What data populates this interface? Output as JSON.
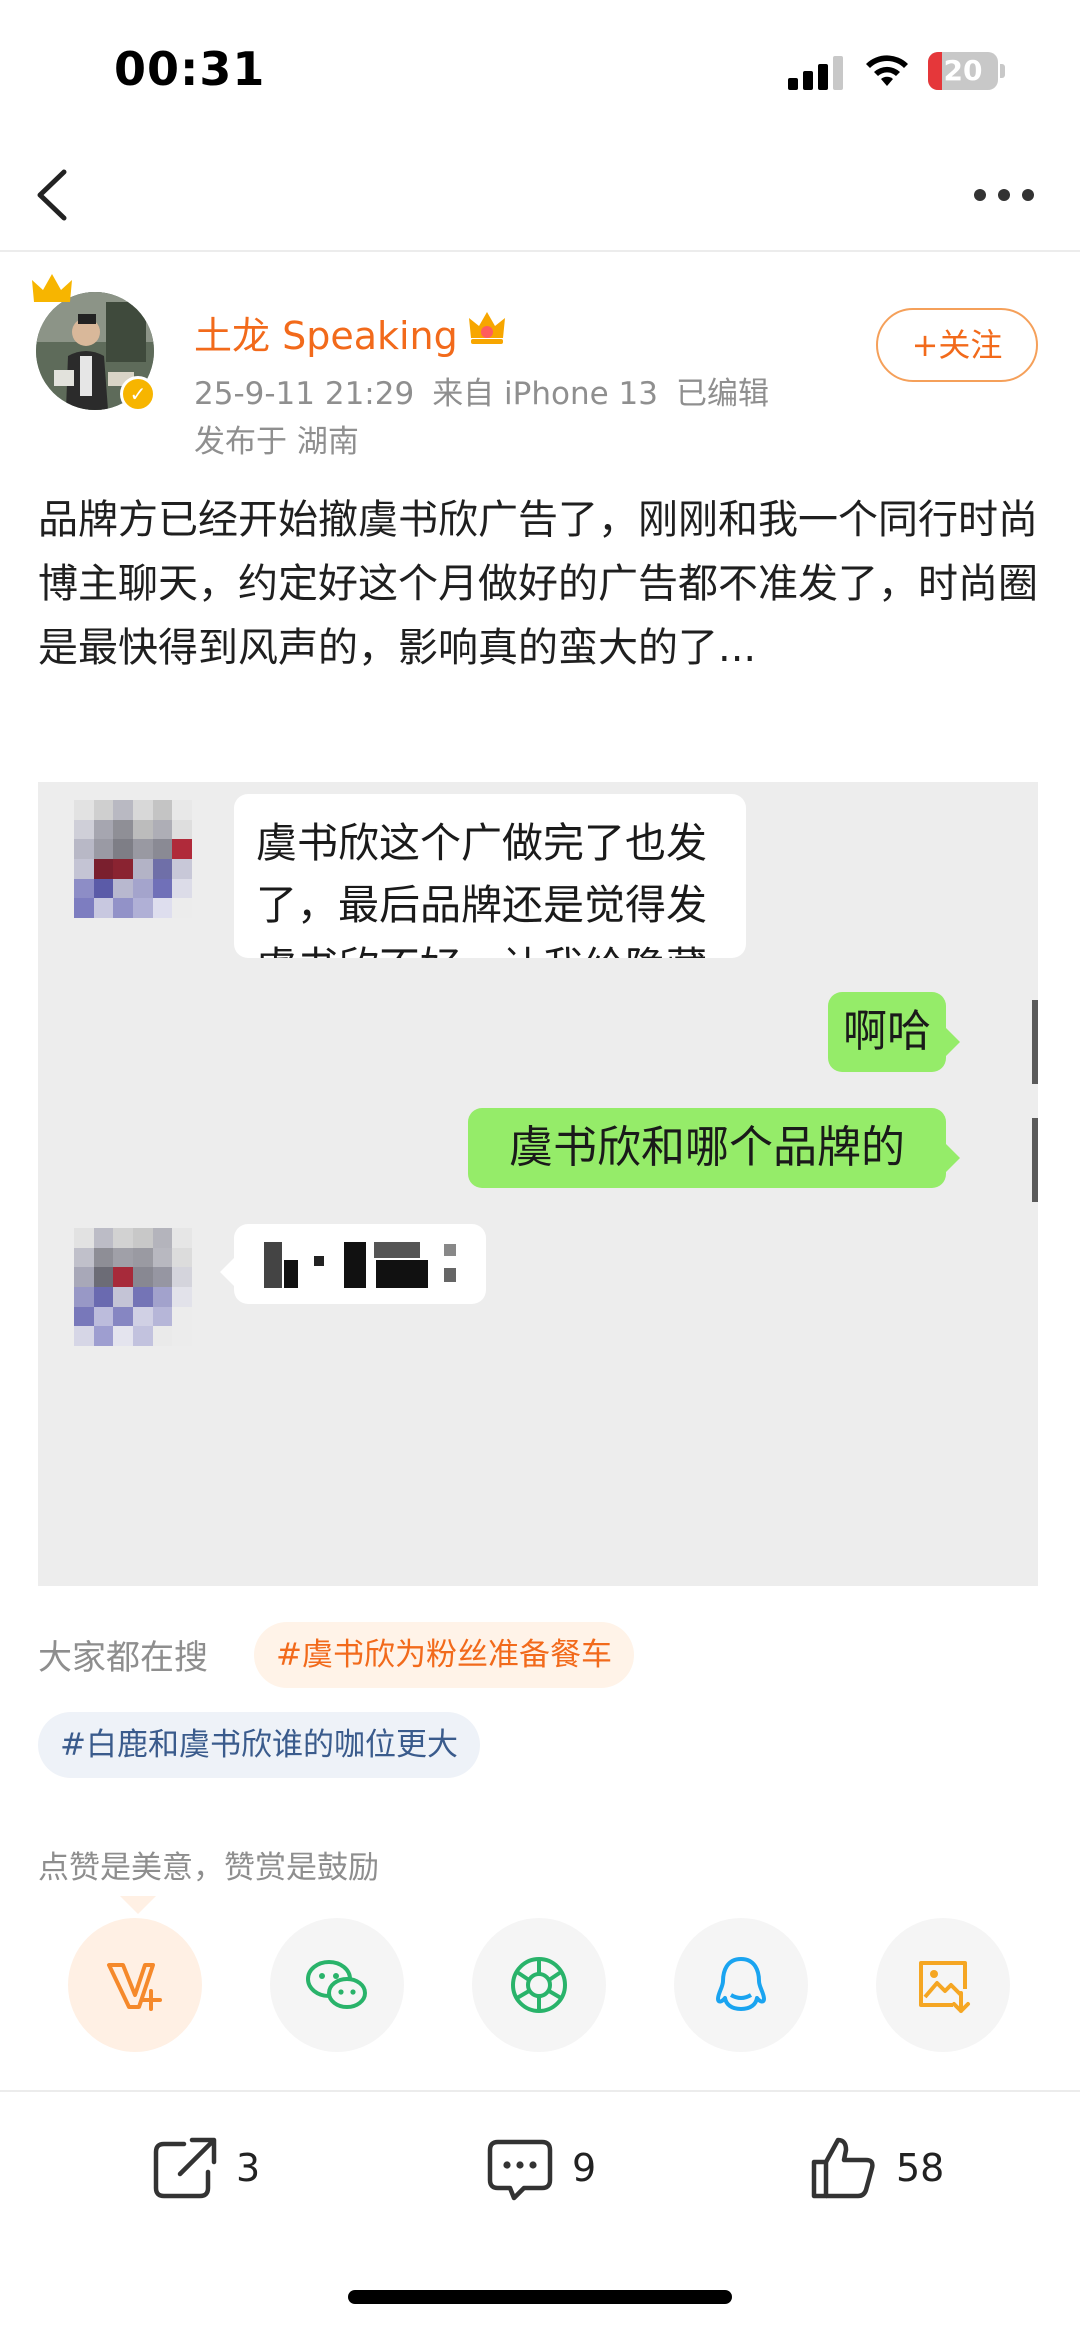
{
  "status_bar": {
    "time": "00:31",
    "battery": "20",
    "battery_level": 0.2
  },
  "post": {
    "author": "土龙 Speaking",
    "date": "25-9-11 21:29",
    "source": "来自 iPhone 13",
    "edited": "已编辑",
    "location": "发布于 湖南",
    "follow_label": "+关注",
    "text": "品牌方已经开始撤虞书欣广告了，刚刚和我一个同行时尚博主聊天，约定好这个月做好的广告都不准发了，时尚圈是最快得到风声的，影响真的蛮大的了..."
  },
  "chat": {
    "msg1": "虞书欣这个广做完了也发了，最后品牌还是觉得发虞书欣不好，让我给隐藏～",
    "msg2": "啊哈",
    "msg3": "虞书欣和哪个品牌的"
  },
  "search": {
    "label": "大家都在搜",
    "tag1": "#虞书欣为粉丝准备餐车",
    "tag2": "#白鹿和虞书欣谁的咖位更大"
  },
  "reward_text": "点赞是美意，赞赏是鼓励",
  "share_icons": [
    "reward-icon",
    "wechat-icon",
    "moments-icon",
    "qq-icon",
    "save-image-icon"
  ],
  "actions": {
    "repost": "3",
    "comment": "9",
    "like": "58"
  },
  "colors": {
    "accent": "#f26a1b",
    "chat_green": "#95ec69",
    "chat_bg": "#ededed"
  }
}
